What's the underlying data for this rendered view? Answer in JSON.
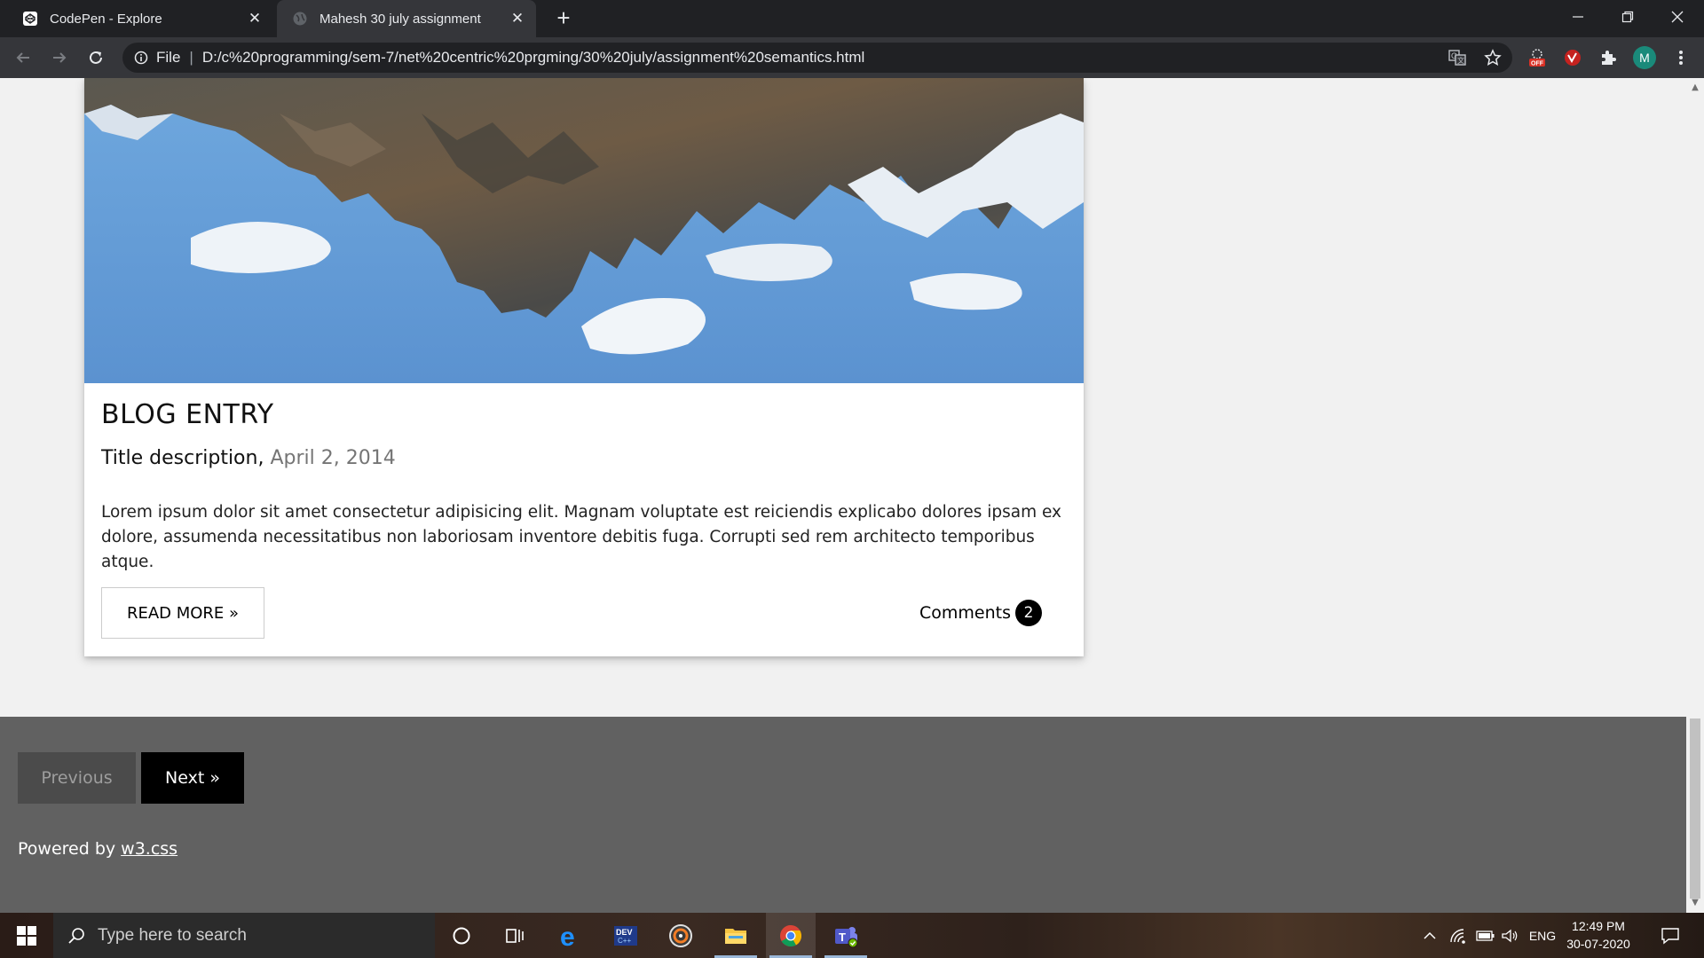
{
  "browser": {
    "tabs": [
      {
        "title": "CodePen - Explore",
        "active": false
      },
      {
        "title": "Mahesh 30 july assignment",
        "active": true
      }
    ],
    "address": {
      "scheme": "File",
      "url": "D:/c%20programming/sem-7/net%20centric%20prgming/30%20july/assignment%20semantics.html"
    },
    "profile_initial": "M"
  },
  "blog": {
    "title": "BLOG ENTRY",
    "subtitle": "Title description,",
    "date": "April 2, 2014",
    "body": "Lorem ipsum dolor sit amet consectetur adipisicing elit. Magnam voluptate est reiciendis explicabo dolores ipsam ex dolore, assumenda necessitatibus non laboriosam inventore debitis fuga. Corrupti sed rem architecto temporibus atque.",
    "read_more": "READ MORE »",
    "comments_label": "Comments",
    "comments_count": "2"
  },
  "pagination": {
    "previous": "Previous",
    "next": "Next »"
  },
  "footer": {
    "powered_prefix": "Powered by",
    "powered_link": "w3.css"
  },
  "taskbar": {
    "search_placeholder": "Type here to search",
    "language": "ENG",
    "time": "12:49 PM",
    "date": "30-07-2020"
  },
  "colors": {
    "footer_bg": "#616161",
    "next_bg": "#000000",
    "prev_bg": "#4b4b4b"
  }
}
